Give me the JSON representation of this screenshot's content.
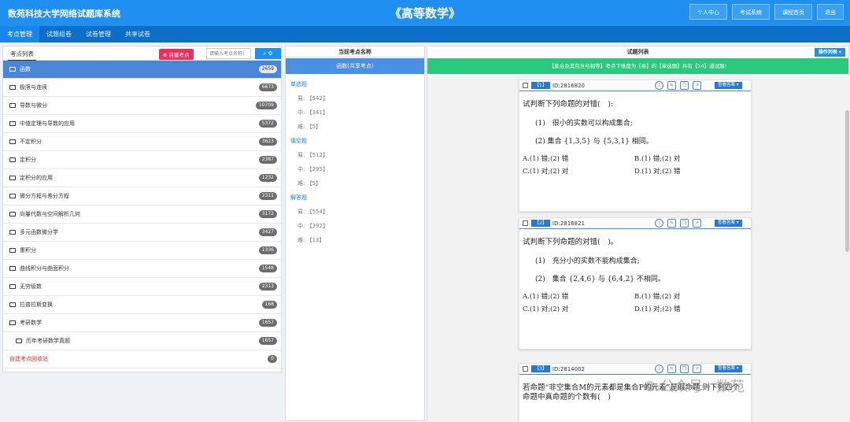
{
  "header": {
    "system_title": "数苑科技大学网络试题库系统",
    "course_title": "《高等数学》",
    "buttons": [
      "个人中心",
      "考试系统",
      "课程首页",
      "退出"
    ]
  },
  "nav": {
    "tabs": [
      "考点管理",
      "试题组卷",
      "试卷管理",
      "共享试卷"
    ]
  },
  "knowledge_panel": {
    "tab": "考点列表",
    "create_button": "自建考点",
    "search_placeholder": "请输入考点名称!",
    "items": [
      {
        "name": "函数",
        "count": "2659"
      },
      {
        "name": "极限与连续",
        "count": "6673"
      },
      {
        "name": "导数与微分",
        "count": "10709"
      },
      {
        "name": "中值定理与导数的应用",
        "count": "5372"
      },
      {
        "name": "不定积分",
        "count": "3623"
      },
      {
        "name": "定积分",
        "count": "2387"
      },
      {
        "name": "定积分的应用",
        "count": "1232"
      },
      {
        "name": "微分方程与差分方程",
        "count": "2311"
      },
      {
        "name": "向量代数与空间解析几何",
        "count": "3172"
      },
      {
        "name": "多元函数微分学",
        "count": "3427"
      },
      {
        "name": "重积分",
        "count": "1336"
      },
      {
        "name": "曲线积分与曲面积分",
        "count": "1548"
      },
      {
        "name": "无穷级数",
        "count": "2313"
      },
      {
        "name": "拉普拉斯变换",
        "count": "168"
      },
      {
        "name": "考研数学",
        "count": "1657"
      },
      {
        "name": "历年考研数学真题",
        "count": "1657"
      },
      {
        "name": "自建考点回收站",
        "count": "0"
      }
    ]
  },
  "current_point": {
    "header": "当前考点名称",
    "name": "函数(共享考点)",
    "types": [
      {
        "name": "单选题",
        "levels": [
          {
            "label": "易:",
            "count": "【542】"
          },
          {
            "label": "中:",
            "count": "【341】"
          },
          {
            "label": "难:",
            "count": "【5】"
          }
        ]
      },
      {
        "name": "填空题",
        "levels": [
          {
            "label": "易:",
            "count": "【512】"
          },
          {
            "label": "中:",
            "count": "【295】"
          },
          {
            "label": "难:",
            "count": "【5】"
          }
        ]
      },
      {
        "name": "解答题",
        "levels": [
          {
            "label": "易:",
            "count": "【554】"
          },
          {
            "label": "中:",
            "count": "【392】"
          },
          {
            "label": "难:",
            "count": "【13】"
          }
        ]
      }
    ]
  },
  "question_list": {
    "header": "试题列表",
    "op_button": "操作列表",
    "banner": "【集合及其包含与相等】考点下难度为【易】的【单选题】共有【14】道试题!",
    "answer_label": "查看答案",
    "questions": [
      {
        "num": "【1】",
        "id": "ID:2816820",
        "stem": "试判断下列命题的对错(　):",
        "items": [
          "(1)　很小的实数可以构成集合;",
          "(2) 集合 {1,3,5} 与 {5,3,1} 相同。"
        ],
        "options": [
          "A.(1) 错;(2) 错",
          "B.(1) 错;(2) 对",
          "C.(1) 对;(2) 对",
          "D.(1) 对;(2) 错"
        ]
      },
      {
        "num": "【2】",
        "id": "ID:2816821",
        "stem": "试判断下列命题的对错(　)。",
        "items": [
          "(1)　充分小的实数不能构成集合;",
          "(2)　集合 {2,4,6} 与 {6,4,2} 不相同。"
        ],
        "options": [
          "A.(1) 错;(2) 错",
          "B.(1) 错;(2) 对",
          "C.(1) 对;(2) 对",
          "D.(1) 对;(2) 错"
        ]
      },
      {
        "num": "【3】",
        "id": "ID:2814002",
        "stem": "若命题“非空集合M的元素都是集合P的元素”是假命题,则下列四个命题中真命题的个数有(　)"
      }
    ]
  },
  "watermark": "公众号 · 数苑"
}
